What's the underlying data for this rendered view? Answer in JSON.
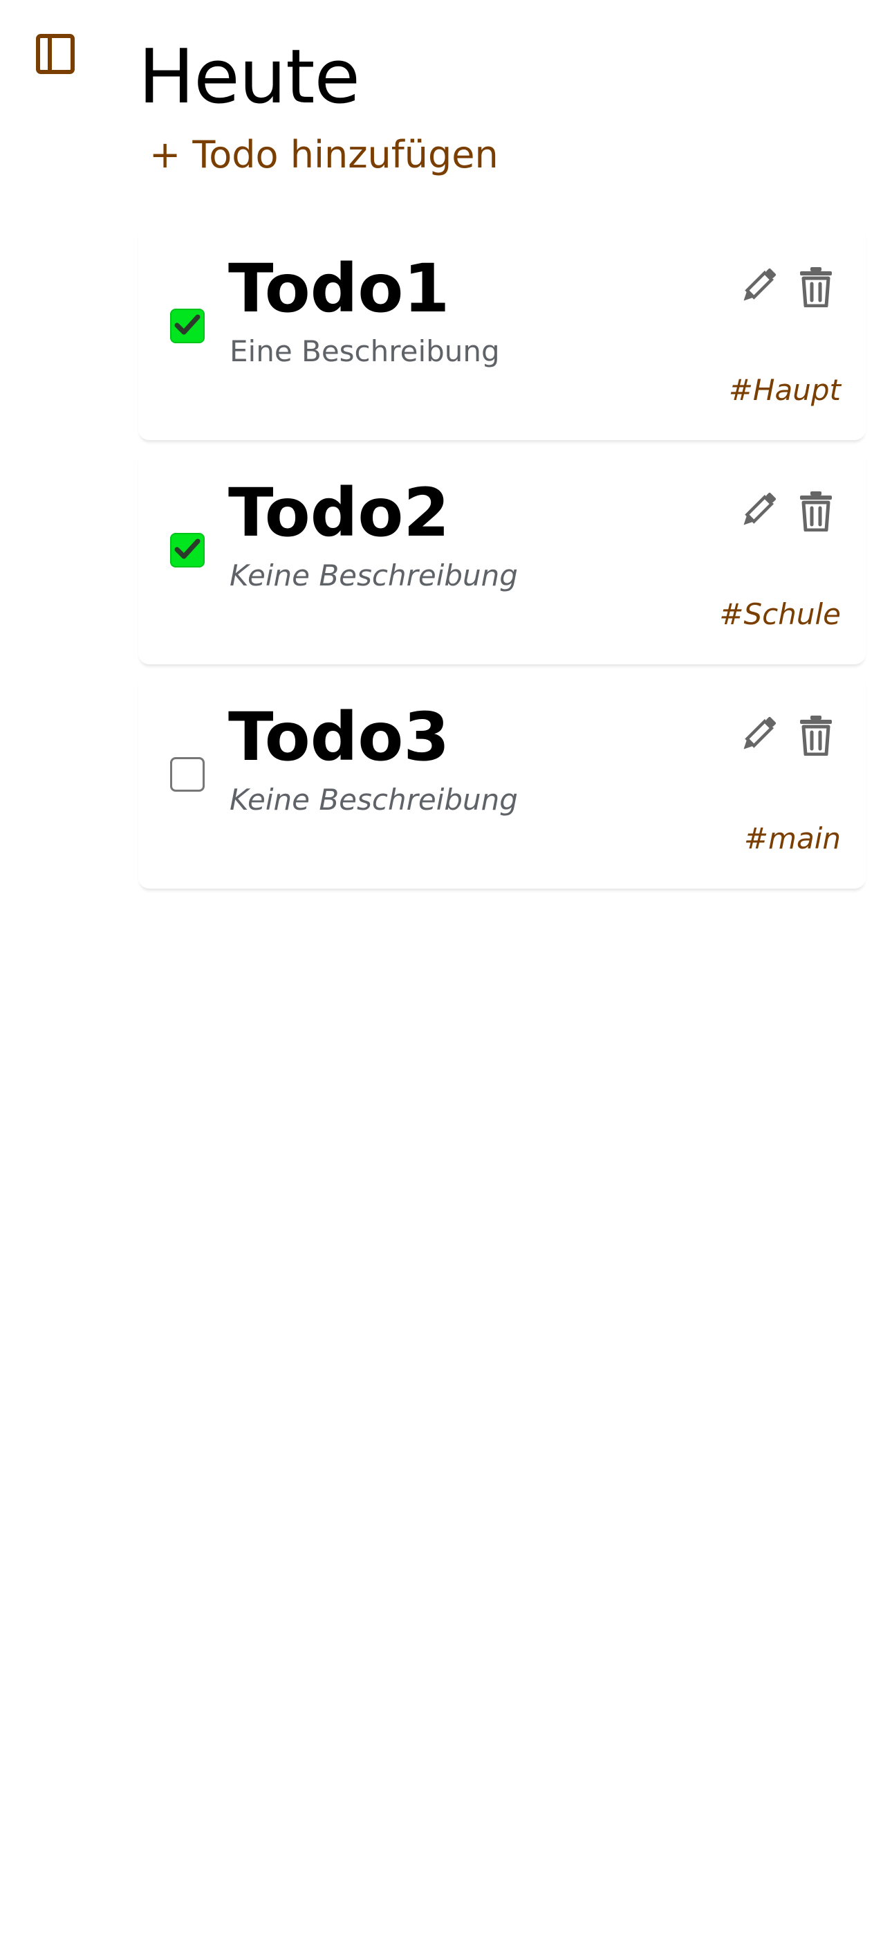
{
  "header": {
    "title": "Heute",
    "add_label": "+ Todo hinzufügen"
  },
  "colors": {
    "accent": "#7a3f00",
    "checked": "#00e51e",
    "text_secondary": "#5f6368"
  },
  "icons": {
    "sidebar_toggle": "sidebar-panel-icon",
    "edit": "pencil-icon",
    "delete": "trash-icon",
    "check": "checkmark-icon"
  },
  "todos": [
    {
      "title": "Todo1",
      "description": "Eine Beschreibung",
      "tag": "#Haupt",
      "checked": true
    },
    {
      "title": "Todo2",
      "description": "Keine Beschreibung",
      "tag": "#Schule",
      "checked": true
    },
    {
      "title": "Todo3",
      "description": "Keine Beschreibung",
      "tag": "#main",
      "checked": false
    }
  ]
}
